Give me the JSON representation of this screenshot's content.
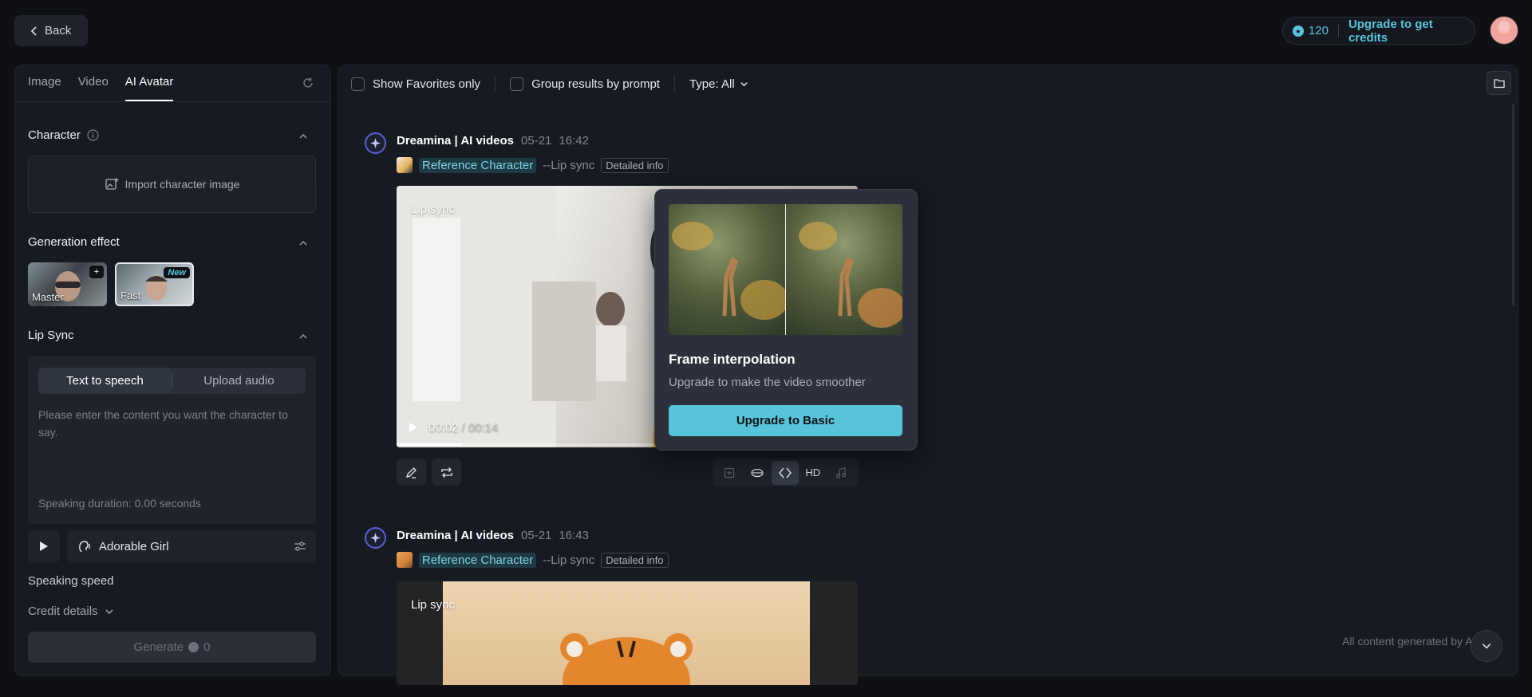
{
  "header": {
    "back_label": "Back",
    "credits": "120",
    "upgrade_label": "Upgrade to get credits"
  },
  "sidebar": {
    "tabs": [
      {
        "label": "Image"
      },
      {
        "label": "Video"
      },
      {
        "label": "AI Avatar"
      }
    ],
    "character": {
      "title": "Character",
      "import_label": "Import character image"
    },
    "generation_effect": {
      "title": "Generation effect",
      "options": [
        {
          "label": "Master",
          "badge": "+"
        },
        {
          "label": "Fast",
          "badge": "New"
        }
      ]
    },
    "lip_sync": {
      "title": "Lip Sync",
      "modes": [
        "Text to speech",
        "Upload audio"
      ],
      "placeholder": "Please enter the content you want the character to say.",
      "duration": "Speaking duration: 0.00 seconds",
      "voice": "Adorable Girl"
    },
    "speaking_speed_title": "Speaking speed",
    "credit_details_label": "Credit details",
    "generate": {
      "label": "Generate",
      "cost": "0"
    }
  },
  "toolbar": {
    "show_favorites": "Show Favorites only",
    "group_results": "Group results by prompt",
    "type_filter": "Type: All"
  },
  "generations": [
    {
      "name": "Dreamina | AI videos",
      "date": "05-21",
      "time": "16:42",
      "ref_label": "Reference Character",
      "mode": "--Lip sync",
      "detail": "Detailed info",
      "video_label": "Lip sync",
      "current_time": "00:02",
      "duration": "/ 00:14",
      "progress": 0.14
    },
    {
      "name": "Dreamina | AI videos",
      "date": "05-21",
      "time": "16:43",
      "ref_label": "Reference Character",
      "mode": "--Lip sync",
      "detail": "Detailed info",
      "video_label": "Lip sync"
    }
  ],
  "video_tools": {
    "hd_label": "HD"
  },
  "popover": {
    "title": "Frame interpolation",
    "subtitle": "Upgrade to make the video smoother",
    "button": "Upgrade to Basic"
  },
  "footer_note": "All content generated by A",
  "colors": {
    "accent": "#58c4dc",
    "background": "#0e1014",
    "panel": "#161a21"
  }
}
